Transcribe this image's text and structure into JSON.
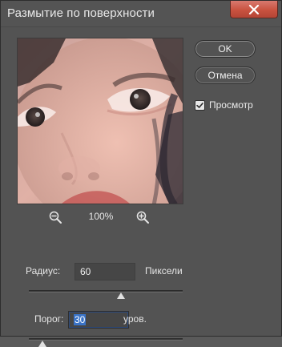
{
  "window": {
    "title": "Размытие по поверхности"
  },
  "preview": {
    "zoom_percent": "100%",
    "zoom_out_icon": "zoom-out-icon",
    "zoom_in_icon": "zoom-in-icon"
  },
  "buttons": {
    "ok": "OK",
    "cancel": "Отмена"
  },
  "preview_toggle": {
    "label": "Просмотр",
    "checked": true
  },
  "radius": {
    "label": "Радиус:",
    "value": "60",
    "unit": "Пиксели",
    "slider_fraction": 0.6
  },
  "threshold": {
    "label": "Порог:",
    "value": "30",
    "unit": "уров.",
    "slider_fraction": 0.09
  },
  "colors": {
    "close_button": "#c9523f",
    "selection": "#3a73c7"
  }
}
